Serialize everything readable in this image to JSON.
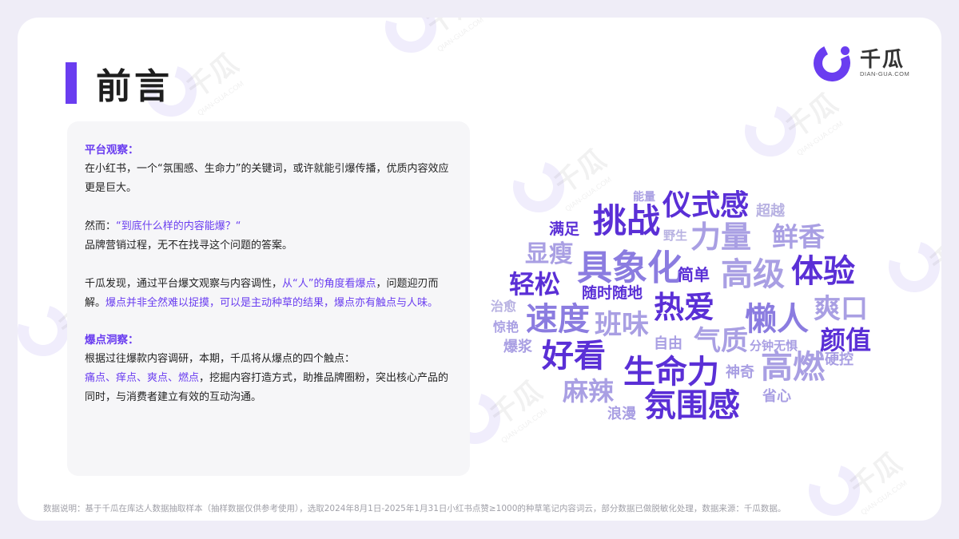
{
  "title": "前言",
  "logo": {
    "name": "千瓜",
    "sub": "DIAN-GUA.COM"
  },
  "watermark": {
    "text": "千瓜",
    "sub": "QIAN-GUA.COM"
  },
  "section1": {
    "title": "平台观察：",
    "p1": "在小红书，一个“氛围感、生命力”的关键词，或许就能引爆传播，优质内容效应更是巨大。",
    "p2_prefix": "然而：",
    "p2_highlight": "“到底什么样的内容能爆？“",
    "p3": "品牌营销过程，无不在找寻这个问题的答案。",
    "p4_a": "千瓜发现，通过平台爆文观察与内容调性，",
    "p4_b": "从“人”的角度看爆点",
    "p4_c": "，问题迎刃而解。",
    "p4_d": "爆点并非全然难以捉摸，可以是主动种草的结果，爆点亦有触点与人味。"
  },
  "section2": {
    "title": "爆点洞察：",
    "p1": "根据过往爆款内容调研，本期，千瓜将从爆点的四个触点：",
    "p2_highlight": "痛点、痒点、爽点、燃点",
    "p2_rest": "，挖掘内容打造方式，助推品牌圈粉，突出核心产品的同时，与消费者建立有效的互动沟通。"
  },
  "word_cloud": [
    {
      "text": "能量",
      "tone": "c3"
    },
    {
      "text": "仪式感",
      "tone": "c1"
    },
    {
      "text": "超越",
      "tone": "c4"
    },
    {
      "text": "满足",
      "tone": "c1"
    },
    {
      "text": "挑战",
      "tone": "c1"
    },
    {
      "text": "野生",
      "tone": "c4"
    },
    {
      "text": "力量",
      "tone": "c3"
    },
    {
      "text": "鲜香",
      "tone": "c3"
    },
    {
      "text": "显瘦",
      "tone": "c3"
    },
    {
      "text": "具象化",
      "tone": "c2"
    },
    {
      "text": "简单",
      "tone": "c1"
    },
    {
      "text": "高级",
      "tone": "c3"
    },
    {
      "text": "体验",
      "tone": "c1"
    },
    {
      "text": "轻松",
      "tone": "c1"
    },
    {
      "text": "随时随地",
      "tone": "c1"
    },
    {
      "text": "热爱",
      "tone": "c1"
    },
    {
      "text": "爽口",
      "tone": "c3"
    },
    {
      "text": "治愈",
      "tone": "c4"
    },
    {
      "text": "速度",
      "tone": "c2"
    },
    {
      "text": "班味",
      "tone": "c3"
    },
    {
      "text": "懒人",
      "tone": "c2"
    },
    {
      "text": "惊艳",
      "tone": "c3"
    },
    {
      "text": "颜值",
      "tone": "c1"
    },
    {
      "text": "爆浆",
      "tone": "c3"
    },
    {
      "text": "自由",
      "tone": "c3"
    },
    {
      "text": "气质",
      "tone": "c3"
    },
    {
      "text": "分钟无惧",
      "tone": "c3"
    },
    {
      "text": "好看",
      "tone": "c1"
    },
    {
      "text": "硬控",
      "tone": "c3"
    },
    {
      "text": "生命力",
      "tone": "c1"
    },
    {
      "text": "神奇",
      "tone": "c3"
    },
    {
      "text": "高燃",
      "tone": "c3"
    },
    {
      "text": "麻辣",
      "tone": "c3"
    },
    {
      "text": "省心",
      "tone": "c3"
    },
    {
      "text": "浪漫",
      "tone": "c3"
    },
    {
      "text": "氛围感",
      "tone": "c1"
    }
  ],
  "footer": "数据说明：基于千瓜在库达人数据抽取样本（抽样数据仅供参考使用），选取2024年8月1日-2025年1月31日小红书点赞≥1000的种草笔记内容词云，部分数据已做脱敏化处理，数据来源：千瓜数据。"
}
